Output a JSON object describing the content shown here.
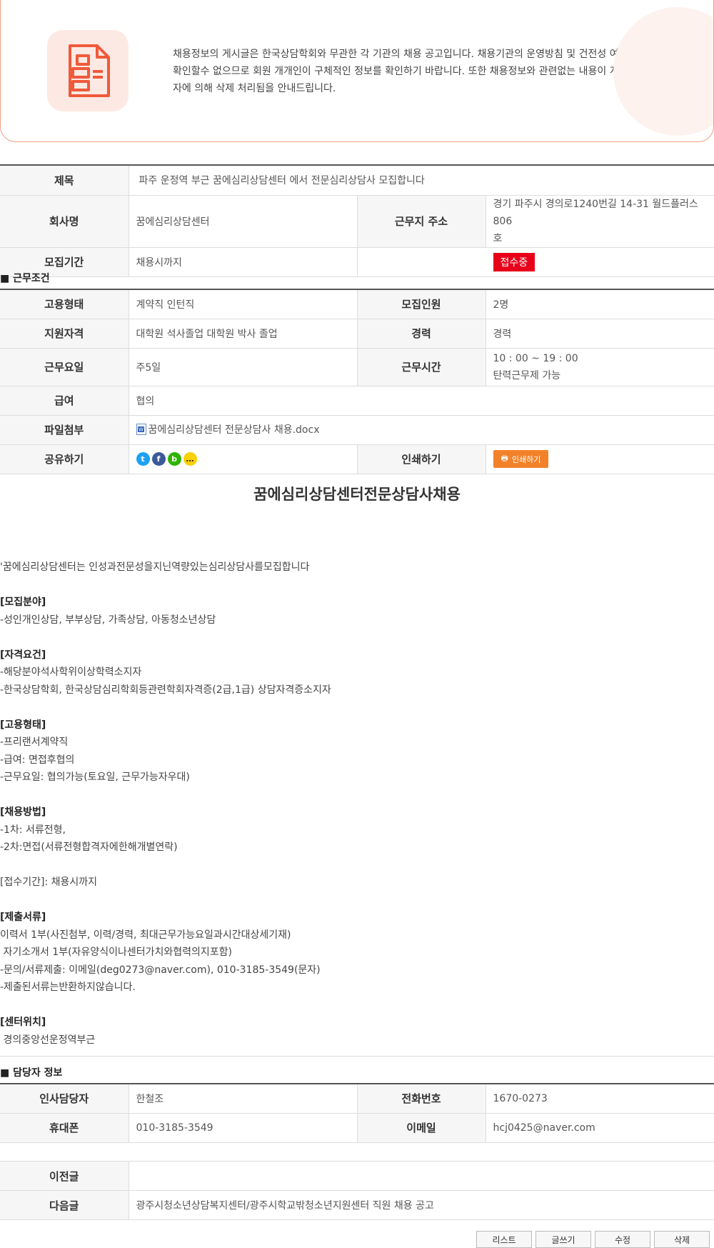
{
  "notice": {
    "line1": "채용정보의 게시글은 한국상담학회와 무관한 각 기관의 채용 공고입니다. 채용기관의 운영방침 및 건전성 여부를 학회에서",
    "line2": "확인할수 없으므로 회원 개개인이 구체적인 정보를 확인하기 바랍니다. 또한 채용정보와 관련없는 내용이 게시될 경우 관리",
    "line3": "자에 의해 삭제 처리됨을 안내드립니다."
  },
  "post": {
    "title_label": "제목",
    "title": "파주 운정역 부근 꿈에심리상담센터 에서 전문심리상담사 모집합니다",
    "company_label": "회사명",
    "company": "꿈에심리상담센터",
    "address_label": "근무지 주소",
    "address_line1": "경기 파주시 경의로1240번길 14-31 월드플러스806",
    "address_line2": "호",
    "period_label": "모집기간",
    "period": "채용시까지",
    "status": "접수중"
  },
  "conditions": {
    "section_title": "■ 근무조건",
    "employment_label": "고용형태",
    "employment": "계약직 인턴직",
    "headcount_label": "모집인원",
    "headcount": "2명",
    "qualification_label": "지원자격",
    "qualification": "대학원 석사졸업 대학원 박사 졸업",
    "career_label": "경력",
    "career": "경력",
    "workdays_label": "근무요일",
    "workdays": "주5일",
    "hours_label": "근무시간",
    "hours_line1": "10 : 00 ~ 19 : 00",
    "hours_line2": "탄력근무제 가능",
    "salary_label": "급여",
    "salary": "협의",
    "attachment_label": "파일첨부",
    "attachment": "꿈에심리상담센터 전문상담사 채용.docx",
    "share_label": "공유하기",
    "print_label": "인쇄하기",
    "print_button": "인쇄하기"
  },
  "content": {
    "heading": "꿈에심리상담센터전문상담사채용",
    "lines": [
      {
        "text": "'꿈에심리상담센터는 인성과전문성을지닌역량있는심리상담사를모집합니다",
        "sec": false
      },
      {
        "text": "",
        "sec": false
      },
      {
        "text": "[모집분야]",
        "sec": true
      },
      {
        "text": "-성인개인상담, 부부상담, 가족상담, 아동청소년상담",
        "sec": false
      },
      {
        "text": "",
        "sec": false
      },
      {
        "text": "[자격요건]",
        "sec": true
      },
      {
        "text": "-해당분야석사학위이상학력소지자",
        "sec": false
      },
      {
        "text": "-한국상담학회, 한국상담심리학회등관련학회자격증(2급,1급) 상담자격증소지자",
        "sec": false
      },
      {
        "text": "",
        "sec": false
      },
      {
        "text": "[고용형태]",
        "sec": true
      },
      {
        "text": "-프리랜서계약직",
        "sec": false
      },
      {
        "text": "-급여: 면접후협의",
        "sec": false
      },
      {
        "text": "-근무요일: 협의가능(토요일, 근무가능자우대)",
        "sec": false
      },
      {
        "text": "",
        "sec": false
      },
      {
        "text": "[채용방법]",
        "sec": true
      },
      {
        "text": "-1차: 서류전형,",
        "sec": false
      },
      {
        "text": "-2차:면접(서류전형합격자에한해개별연락)",
        "sec": false
      },
      {
        "text": "",
        "sec": false
      },
      {
        "text": "[접수기간]: 채용시까지",
        "sec": false
      },
      {
        "text": "",
        "sec": false
      },
      {
        "text": "[제출서류]",
        "sec": true
      },
      {
        "text": "이력서 1부(사진첨부, 이력/경력, 최대근무가능요일과시간대상세기재)",
        "sec": false
      },
      {
        "text": " 자기소개서 1부(자유양식이나센터가치와협력의지포함)",
        "sec": false
      },
      {
        "text": "-문의/서류제출: 이메일(deg0273@naver.com), 010-3185-3549(문자)",
        "sec": false
      },
      {
        "text": "-제출된서류는반환하지않습니다.",
        "sec": false
      },
      {
        "text": "",
        "sec": false
      },
      {
        "text": "[센터위치]",
        "sec": true
      },
      {
        "text": " 경의중앙선운정역부근",
        "sec": false
      }
    ]
  },
  "contact": {
    "section_title": "■ 담당자 정보",
    "manager_label": "인사담당자",
    "manager": "한철조",
    "phone_label": "전화번호",
    "phone": "1670-0273",
    "mobile_label": "휴대폰",
    "mobile": "010-3185-3549",
    "email_label": "이메일",
    "email": "hcj0425@naver.com"
  },
  "nav": {
    "prev_label": "이전글",
    "prev": "",
    "next_label": "다음글",
    "next": "광주시청소년상담복지센터/광주시학교밖청소년지원센터 직원 채용 공고"
  },
  "buttons": {
    "list": "리스트",
    "write": "글쓰기",
    "edit": "수정",
    "delete": "삭제"
  },
  "colors": {
    "accent": "#ef5a3a",
    "status_red": "#e8001a",
    "print_orange": "#f2822a"
  }
}
